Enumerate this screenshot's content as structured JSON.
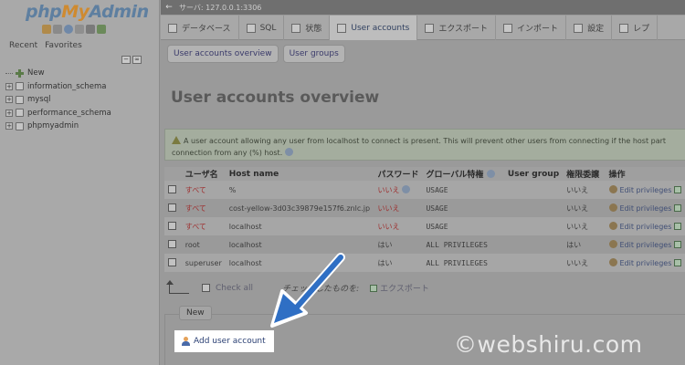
{
  "app": {
    "logo_php": "php",
    "logo_my": "My",
    "logo_admin": "Admin"
  },
  "nav": {
    "tabs": [
      "Recent",
      "Favorites"
    ],
    "collapse_glyph": "−",
    "link_glyph": "∞",
    "items": [
      {
        "label": "New",
        "type": "new"
      },
      {
        "label": "information_schema",
        "type": "db"
      },
      {
        "label": "mysql",
        "type": "db"
      },
      {
        "label": "performance_schema",
        "type": "db"
      },
      {
        "label": "phpmyadmin",
        "type": "db"
      }
    ]
  },
  "topbar": {
    "back_glyph": "←",
    "server": "サーバ: 127.0.0.1:3306"
  },
  "tabs": [
    {
      "label": "データベース",
      "icon": "database-icon",
      "active": false
    },
    {
      "label": "SQL",
      "icon": "sql-icon",
      "active": false
    },
    {
      "label": "状態",
      "icon": "status-icon",
      "active": false
    },
    {
      "label": "User accounts",
      "icon": "user-accounts-icon",
      "active": true
    },
    {
      "label": "エクスポート",
      "icon": "export-icon",
      "active": false
    },
    {
      "label": "インポート",
      "icon": "import-icon",
      "active": false
    },
    {
      "label": "設定",
      "icon": "settings-icon",
      "active": false
    },
    {
      "label": "レプ",
      "icon": "replication-icon",
      "active": false
    }
  ],
  "subtabs": [
    "User accounts overview",
    "User groups"
  ],
  "page_title": "User accounts overview",
  "notice": {
    "line1": "A user account allowing any user from localhost to connect is present. This will prevent other users from connecting if the host part",
    "line2": "connection from any (%) host."
  },
  "table": {
    "headers": [
      "",
      "ユーザ名",
      "Host name",
      "パスワード",
      "グローバル特権",
      "User group",
      "権限委譲",
      "操作"
    ],
    "rows": [
      {
        "user": "すべて",
        "user_red": true,
        "host": "%",
        "password": "いいえ",
        "password_red": true,
        "password_help": true,
        "privileges": "USAGE",
        "group": "",
        "grant": "いいえ",
        "action": "Edit privileges"
      },
      {
        "user": "すべて",
        "user_red": true,
        "host": "cost-yellow-3d03c39879e157f6.znlc.jp",
        "password": "いいえ",
        "password_red": true,
        "password_help": false,
        "privileges": "USAGE",
        "group": "",
        "grant": "いいえ",
        "action": "Edit privileges"
      },
      {
        "user": "すべて",
        "user_red": true,
        "host": "localhost",
        "password": "いいえ",
        "password_red": true,
        "password_help": false,
        "privileges": "USAGE",
        "group": "",
        "grant": "いいえ",
        "action": "Edit privileges"
      },
      {
        "user": "root",
        "user_red": false,
        "host": "localhost",
        "password": "はい",
        "password_red": false,
        "password_help": false,
        "privileges": "ALL PRIVILEGES",
        "group": "",
        "grant": "はい",
        "action": "Edit privileges"
      },
      {
        "user": "superuser",
        "user_red": false,
        "host": "localhost",
        "password": "はい",
        "password_red": false,
        "password_help": false,
        "privileges": "ALL PRIVILEGES",
        "group": "",
        "grant": "いいえ",
        "action": "Edit privileges"
      }
    ]
  },
  "bottom": {
    "check_all": "Check all",
    "with_selected": "チェックしたものを:",
    "export": "エクスポート"
  },
  "new_section": {
    "legend": "New",
    "add_user": "Add user account"
  },
  "watermark": "©webshiru.com",
  "colors": {
    "callout": "#2f6fc4",
    "highlight": "#ffffff"
  }
}
